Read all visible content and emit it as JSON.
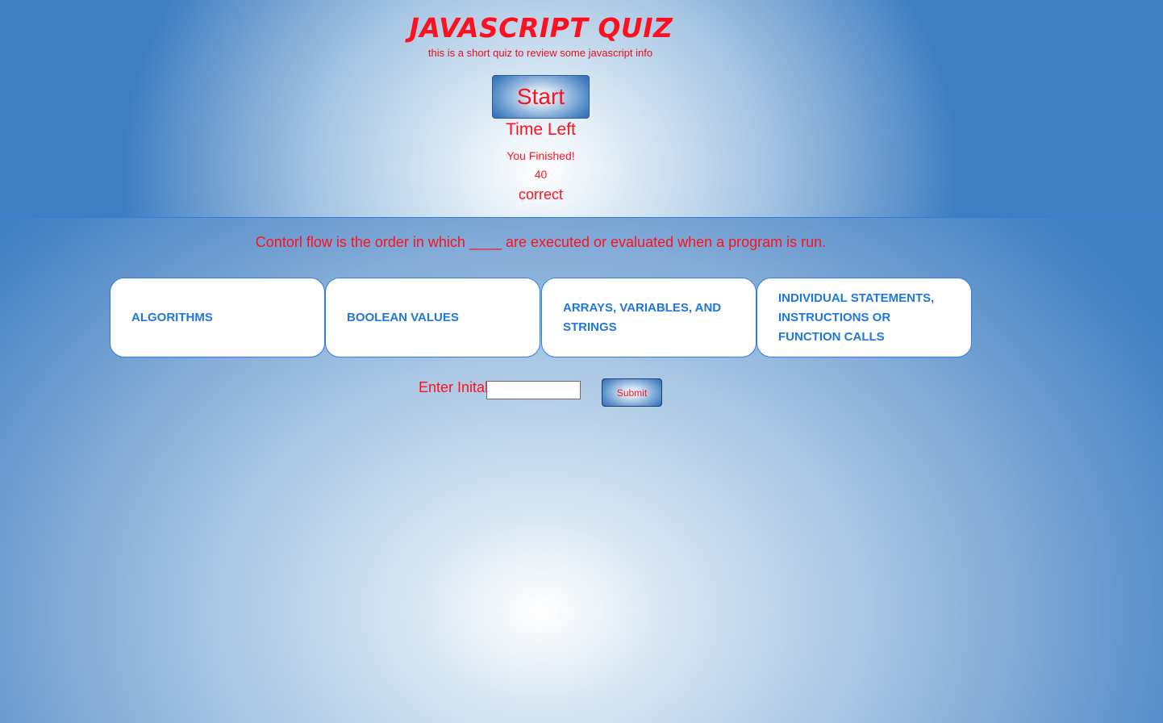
{
  "header": {
    "title": "JAVASCRIPT QUIZ",
    "subtitle": "this is a short quiz to review some javascript info"
  },
  "controls": {
    "start_label": "Start",
    "time_left_label": "Time Left"
  },
  "result": {
    "finished_text": "You Finished!",
    "score": "40",
    "correct_label": "correct"
  },
  "question": {
    "text": "Contorl flow is the order in which ____ are executed or evaluated when a program is run.",
    "choices": [
      "ALGORITHMS",
      "BOOLEAN VALUES",
      "ARRAYS, VARIABLES, AND STRINGS",
      "INDIVIDUAL STATEMENTS, INSTRUCTIONS OR FUNCTION CALLS"
    ]
  },
  "initials": {
    "label": "Enter Initals",
    "value": "",
    "submit_label": "Submit"
  },
  "colors": {
    "accent_text": "#ff1020",
    "choice_text": "#1f78d8",
    "divider": "#2f7de1"
  }
}
